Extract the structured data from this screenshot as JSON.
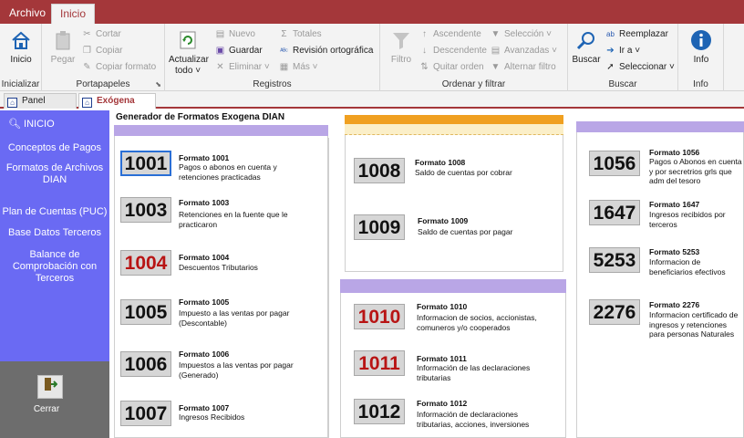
{
  "menu": {
    "archivo": "Archivo",
    "inicio": "Inicio"
  },
  "ribbon": {
    "inicializar": {
      "btn": "Inicio",
      "group": "Inicializar"
    },
    "portapapeles": {
      "pegar": "Pegar",
      "cortar": "Cortar",
      "copiar": "Copiar",
      "copiar_formato": "Copiar formato",
      "group": "Portapapeles"
    },
    "registros": {
      "actualizar1": "Actualizar",
      "actualizar2": "todo",
      "nuevo": "Nuevo",
      "guardar": "Guardar",
      "eliminar": "Eliminar",
      "totales": "Totales",
      "ortografia": "Revisión ortográfica",
      "mas": "Más",
      "group": "Registros"
    },
    "ordenar": {
      "filtro": "Filtro",
      "ascendente": "Ascendente",
      "descendente": "Descendente",
      "quitar": "Quitar orden",
      "seleccion": "Selección",
      "avanzadas": "Avanzadas",
      "alternar": "Alternar filtro",
      "group": "Ordenar y filtrar"
    },
    "buscar": {
      "buscar": "Buscar",
      "reemplazar": "Reemplazar",
      "ir": "Ir a",
      "seleccionar": "Seleccionar",
      "group": "Buscar"
    },
    "info": {
      "btn": "Info",
      "group": "Info"
    }
  },
  "tabs": {
    "panel": "Panel Control",
    "exogena": "Exógena DIAN"
  },
  "sidebar": {
    "inicio": "INICIO",
    "items": [
      "Conceptos de Pagos",
      "Formatos de Archivos DIAN",
      "Plan de Cuentas (PUC)",
      "Base Datos Terceros",
      "Balance de Comprobación con Terceros"
    ],
    "cerrar": "Cerrar"
  },
  "main": {
    "title": "Generador de Formatos Exogena DIAN"
  },
  "formatos": [
    {
      "code": "1001",
      "title": "Formato 1001",
      "desc": "Pagos o abonos en cuenta y retenciones practicadas"
    },
    {
      "code": "1003",
      "title": "Formato 1003",
      "desc": "Retenciones en la fuente que le practicaron"
    },
    {
      "code": "1004",
      "title": "Formato 1004",
      "desc": "Descuentos Tributarios"
    },
    {
      "code": "1005",
      "title": "Formato 1005",
      "desc": "Impuesto a las ventas por pagar (Descontable)"
    },
    {
      "code": "1006",
      "title": "Formato 1006",
      "desc": "Impuestos a las ventas por pagar (Generado)"
    },
    {
      "code": "1007",
      "title": "Formato 1007",
      "desc": "Ingresos Recibidos"
    },
    {
      "code": "1008",
      "title": "Formato 1008",
      "desc": "Saldo de cuentas por cobrar"
    },
    {
      "code": "1009",
      "title": "Formato 1009",
      "desc": "Saldo de cuentas por pagar"
    },
    {
      "code": "1010",
      "title": "Formato 1010",
      "desc": "Informacion de socios, accionistas, comuneros y/o cooperados"
    },
    {
      "code": "1011",
      "title": "Formato 1011",
      "desc": "Información de las declaraciones tributarias"
    },
    {
      "code": "1012",
      "title": "Formato 1012",
      "desc": "Información de declaraciones tributarias, acciones, inversiones"
    },
    {
      "code": "1056",
      "title": "Formato 1056",
      "desc": "Pagos o Abonos en cuenta y por secretrios grls que adm del tesoro"
    },
    {
      "code": "1647",
      "title": "Formato 1647",
      "desc": "Ingresos recibidos por terceros"
    },
    {
      "code": "5253",
      "title": "Formato 5253",
      "desc": "Informacion de beneficiarios efectivos"
    },
    {
      "code": "2276",
      "title": "Formato 2276",
      "desc": "Informacion certificado de ingresos y retenciones para personas Naturales Empleados"
    }
  ],
  "colors": {
    "brand": "#a4373a",
    "sidebar": "#6a6af3",
    "bar_purple": "#b9a6e6",
    "bar_orange": "#f0a020",
    "red_code": "#b81414"
  }
}
